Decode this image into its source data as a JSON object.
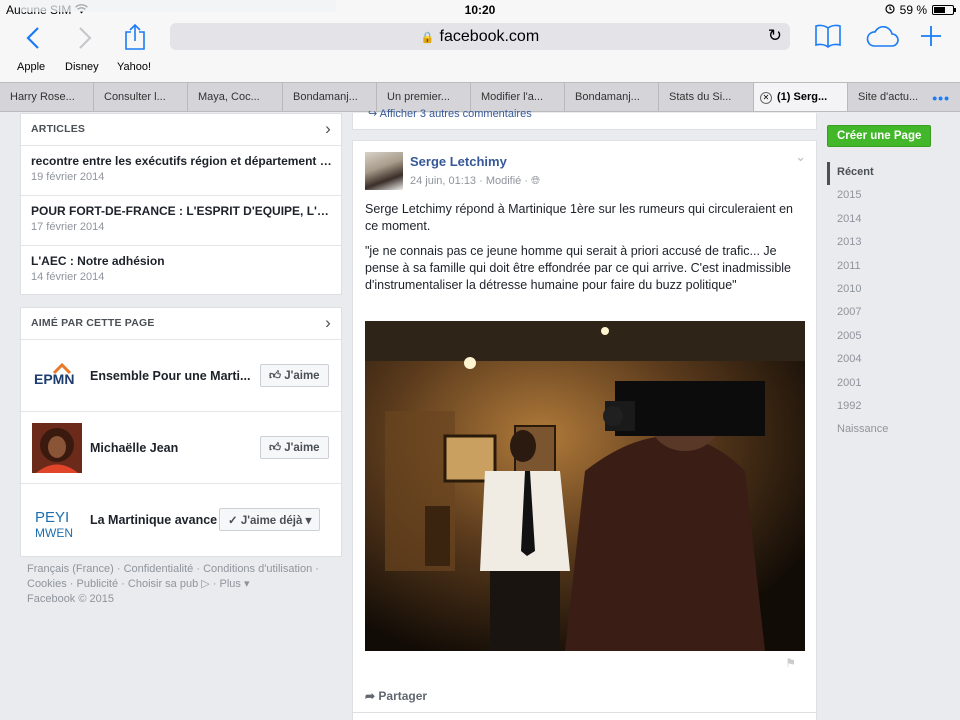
{
  "status": {
    "carrier": "Aucune SIM",
    "time": "10:20",
    "battery": "59 %",
    "battery_level": 0.59
  },
  "browser": {
    "url": "facebook.com",
    "bookmarks": [
      "Apple",
      "Disney",
      "Yahoo!"
    ],
    "tabs": [
      "Harry Rose...",
      "Consulter l...",
      "Maya, Coc...",
      "Bondamanj...",
      "Un premier...",
      "Modifier l'a...",
      "Bondamanj...",
      "Stats du Si...",
      "(1) Serg...",
      "Site d'actu..."
    ],
    "active_tab": 8,
    "more": "•••"
  },
  "articles": {
    "header": "ARTICLES",
    "items": [
      {
        "title": "recontre entre les exécutifs région et département mar...",
        "date": "19 février 2014"
      },
      {
        "title": "POUR FORT-DE-FRANCE : L'ESPRIT D'EQUIPE, L'ESP...",
        "date": "17 février 2014"
      },
      {
        "title": "L'AEC : Notre adhésion",
        "date": "14 février 2014"
      }
    ]
  },
  "liked": {
    "header": "AIMÉ PAR CETTE PAGE",
    "items": [
      {
        "name": "Ensemble Pour une Marti...",
        "button": "J'aime",
        "logo_text": "EPMN"
      },
      {
        "name": "Michaëlle Jean",
        "button": "J'aime"
      },
      {
        "name": "La Martinique avance",
        "button": "J'aime déjà",
        "logo_line1": "PEYI",
        "logo_line2": "MWEN"
      }
    ]
  },
  "footer": {
    "links": [
      "Français (France)",
      "Confidentialité",
      "Conditions d'utilisation",
      "Cookies",
      "Publicité",
      "Choisir sa pub",
      "Plus"
    ],
    "copyright": "Facebook © 2015"
  },
  "post": {
    "comments_link": "Afficher 3 autres commentaires",
    "author": "Serge Letchimy",
    "meta": "24 juin, 01:13 · Modifié ·",
    "text1": "Serge Letchimy répond à Martinique 1ère sur les rumeurs qui circuleraient en ce moment.",
    "text2": "\"je ne connais pas ce jeune homme qui serait à priori accusé de trafic... Je pense à sa famille qui doit être effondrée par ce qui arrive. C'est inadmissible d'instrumentaliser la détresse humaine pour faire du buzz politique\"",
    "share": "Partager"
  },
  "sidebar": {
    "create_page": "Créer une Page",
    "years": [
      "Récent",
      "2015",
      "2014",
      "2013",
      "2011",
      "2010",
      "2007",
      "2005",
      "2004",
      "2001",
      "1992",
      "Naissance"
    ]
  }
}
